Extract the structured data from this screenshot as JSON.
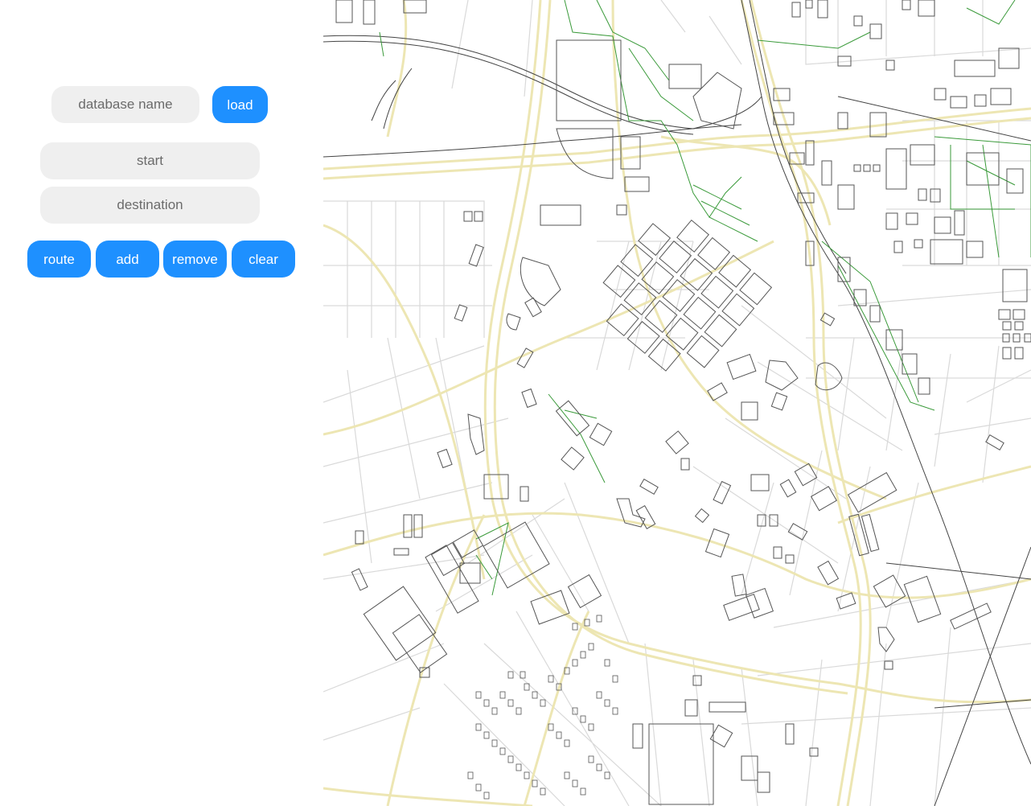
{
  "controls": {
    "database_placeholder": "database name",
    "load_label": "load",
    "start_placeholder": "start",
    "destination_placeholder": "destination",
    "route_label": "route",
    "add_label": "add",
    "remove_label": "remove",
    "clear_label": "clear"
  },
  "colors": {
    "accent": "#1e90ff",
    "input_bg": "#efefef",
    "major_road": "#ede6b3",
    "minor_road": "#d9d9d9",
    "path": "#3a9a3a",
    "building": "#555555",
    "rail": "#444444"
  }
}
